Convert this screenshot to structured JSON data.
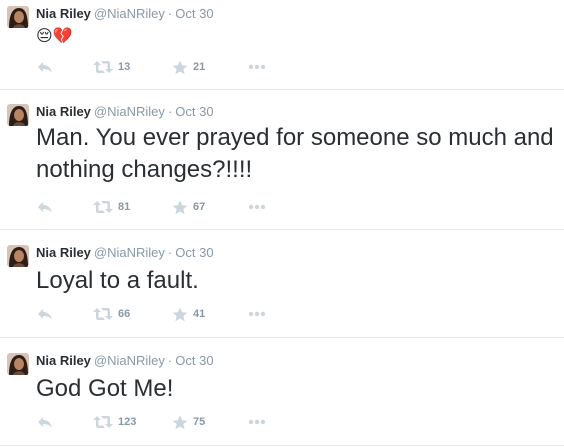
{
  "tweets": [
    {
      "name": "Nia Riley",
      "handle": "@NiaNRiley",
      "separator": "·",
      "time": "Oct 30",
      "text": "😔💔",
      "retweets": "13",
      "favorites": "21"
    },
    {
      "name": "Nia Riley",
      "handle": "@NiaNRiley",
      "separator": "·",
      "time": "Oct 30",
      "text": "Man. You ever prayed for someone so much and nothing changes?!!!!",
      "retweets": "81",
      "favorites": "67"
    },
    {
      "name": "Nia Riley",
      "handle": "@NiaNRiley",
      "separator": "·",
      "time": "Oct 30",
      "text": "Loyal to a fault.",
      "retweets": "66",
      "favorites": "41"
    },
    {
      "name": "Nia Riley",
      "handle": "@NiaNRiley",
      "separator": "·",
      "time": "Oct 30",
      "text": "God Got Me!",
      "retweets": "123",
      "favorites": "75"
    }
  ],
  "icons": {
    "reply": "reply-icon",
    "retweet": "retweet-icon",
    "favorite": "star-icon",
    "more": "more-icon"
  },
  "colors": {
    "name": "#292f33",
    "meta": "#8899a6",
    "action_icon": "#ccd6dd",
    "divider": "#e1e8ed"
  }
}
